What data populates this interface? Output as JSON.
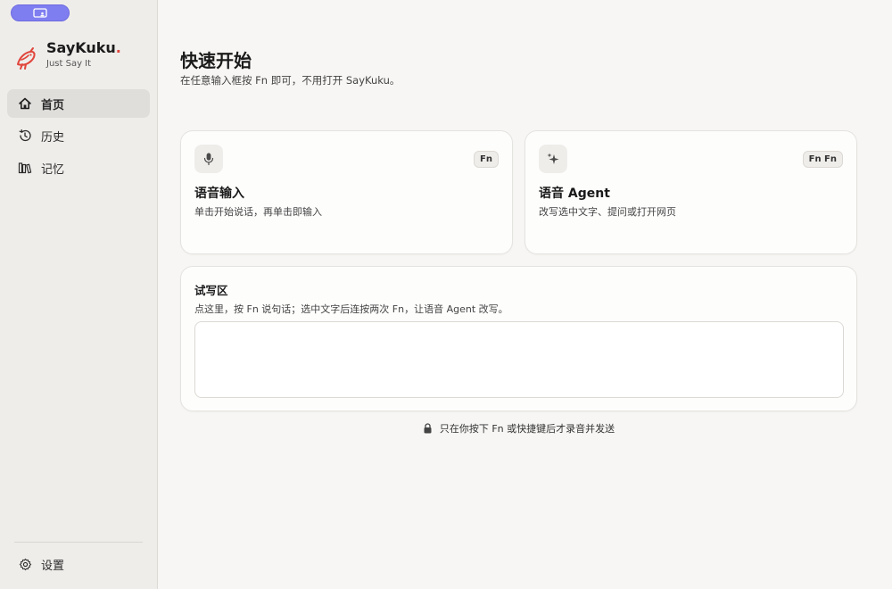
{
  "sidebar": {
    "brand": {
      "name": "SayKuku",
      "dot": ".",
      "tagline": "Just Say It"
    },
    "items": [
      {
        "label": "首页",
        "icon": "home-icon",
        "active": true
      },
      {
        "label": "历史",
        "icon": "history-icon",
        "active": false
      },
      {
        "label": "记忆",
        "icon": "library-icon",
        "active": false
      }
    ],
    "settings_label": "设置"
  },
  "main": {
    "title": "快速开始",
    "subtitle": "在任意输入框按 Fn 即可，不用打开 SayKuku。",
    "cards": [
      {
        "title": "语音输入",
        "desc": "单击开始说话，再单击即输入",
        "shortcut": "Fn",
        "icon": "microphone-icon"
      },
      {
        "title": "语音 Agent",
        "desc": "改写选中文字、提问或打开网页",
        "shortcut": "Fn Fn",
        "icon": "sparkle-icon"
      }
    ],
    "try_area": {
      "title": "试写区",
      "desc": "点这里，按 Fn 说句话；选中文字后连按两次 Fn，让语音 Agent 改写。",
      "value": ""
    },
    "privacy_note": "只在你按下 Fn 或快捷键后才录音并发送"
  },
  "colors": {
    "accent": "#7f7ef0",
    "brand_red": "#e0463c"
  }
}
